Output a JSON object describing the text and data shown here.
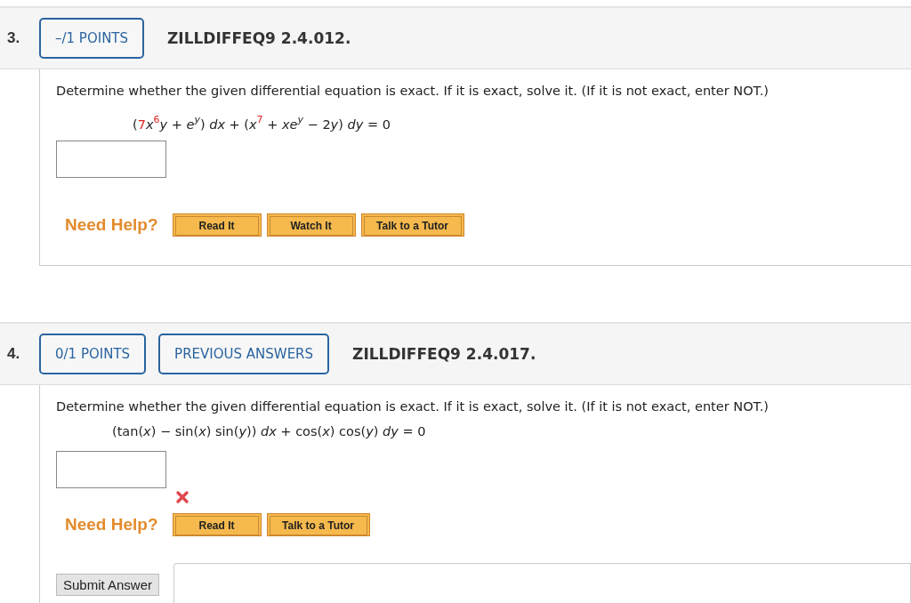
{
  "questions": [
    {
      "number": "3.",
      "badges": [
        "–/1 POINTS"
      ],
      "code": "ZILLDIFFEQ9 2.4.012.",
      "prompt": "Determine whether the given differential equation is exact. If it is exact, solve it. (If it is not exact, enter NOT.)",
      "equation": [
        {
          "text": "(",
          "kind": "plain",
          "highlight": false
        },
        {
          "text": "7",
          "kind": "plain",
          "highlight": true
        },
        {
          "text": "x",
          "kind": "var",
          "highlight": false
        },
        {
          "text": "6",
          "kind": "sup",
          "highlight": true
        },
        {
          "text": "y",
          "kind": "var",
          "highlight": false
        },
        {
          "text": " + ",
          "kind": "plain",
          "highlight": false
        },
        {
          "text": "e",
          "kind": "var",
          "highlight": false
        },
        {
          "text": "y",
          "kind": "supvar",
          "highlight": false
        },
        {
          "text": ") ",
          "kind": "plain",
          "highlight": false
        },
        {
          "text": "dx",
          "kind": "var",
          "highlight": false
        },
        {
          "text": " + (",
          "kind": "plain",
          "highlight": false
        },
        {
          "text": "x",
          "kind": "var",
          "highlight": false
        },
        {
          "text": "7",
          "kind": "sup",
          "highlight": true
        },
        {
          "text": " + ",
          "kind": "plain",
          "highlight": false
        },
        {
          "text": "xe",
          "kind": "var",
          "highlight": false
        },
        {
          "text": "y",
          "kind": "supvar",
          "highlight": false
        },
        {
          "text": " − 2",
          "kind": "plain",
          "highlight": false
        },
        {
          "text": "y",
          "kind": "var",
          "highlight": false
        },
        {
          "text": ") ",
          "kind": "plain",
          "highlight": false
        },
        {
          "text": "dy",
          "kind": "var",
          "highlight": false
        },
        {
          "text": " = 0",
          "kind": "plain",
          "highlight": false
        }
      ],
      "answer": {
        "marked_wrong": false
      },
      "help_label": "Need Help?",
      "help_buttons": [
        "Read It",
        "Watch It",
        "Talk to a Tutor"
      ]
    },
    {
      "number": "4.",
      "badges": [
        "0/1 POINTS",
        "PREVIOUS ANSWERS"
      ],
      "code": "ZILLDIFFEQ9 2.4.017.",
      "prompt": "Determine whether the given differential equation is exact. If it is exact, solve it. (If it is not exact, enter NOT.)",
      "equation": [
        {
          "text": "(tan(",
          "kind": "plain",
          "highlight": false
        },
        {
          "text": "x",
          "kind": "var",
          "highlight": false
        },
        {
          "text": ") − sin(",
          "kind": "plain",
          "highlight": false
        },
        {
          "text": "x",
          "kind": "var",
          "highlight": false
        },
        {
          "text": ") sin(",
          "kind": "plain",
          "highlight": false
        },
        {
          "text": "y",
          "kind": "var",
          "highlight": false
        },
        {
          "text": ")) ",
          "kind": "plain",
          "highlight": false
        },
        {
          "text": "dx",
          "kind": "var",
          "highlight": false
        },
        {
          "text": " + cos(",
          "kind": "plain",
          "highlight": false
        },
        {
          "text": "x",
          "kind": "var",
          "highlight": false
        },
        {
          "text": ") cos(",
          "kind": "plain",
          "highlight": false
        },
        {
          "text": "y",
          "kind": "var",
          "highlight": false
        },
        {
          "text": ") ",
          "kind": "plain",
          "highlight": false
        },
        {
          "text": "dy",
          "kind": "var",
          "highlight": false
        },
        {
          "text": " = 0",
          "kind": "plain",
          "highlight": false
        }
      ],
      "answer": {
        "marked_wrong": true
      },
      "help_label": "Need Help?",
      "help_buttons": [
        "Read It",
        "Talk to a Tutor"
      ],
      "submit_label": "Submit Answer"
    }
  ]
}
